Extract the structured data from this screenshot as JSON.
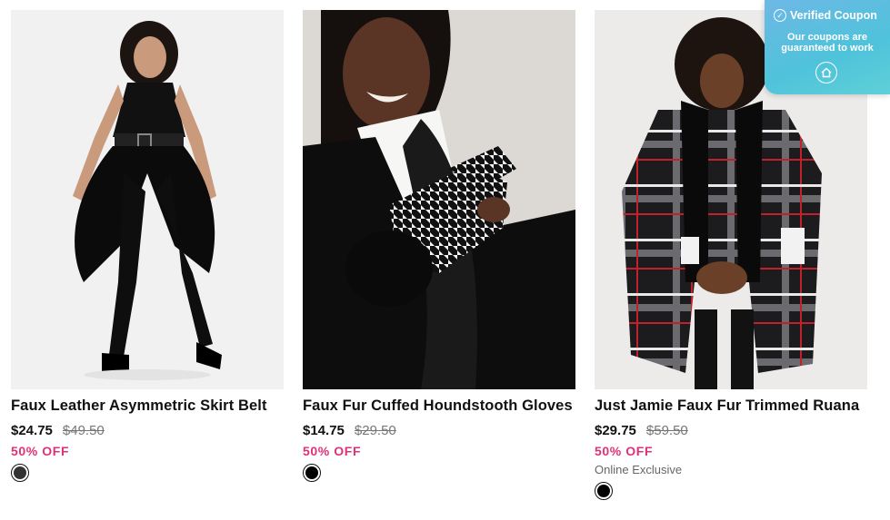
{
  "products": [
    {
      "name": "Faux Leather Asymmetric Skirt Belt",
      "price": "$24.75",
      "original_price": "$49.50",
      "discount": "50% OFF",
      "exclusive": "",
      "swatch_color": "#333333"
    },
    {
      "name": "Faux Fur Cuffed Houndstooth Gloves",
      "price": "$14.75",
      "original_price": "$29.50",
      "discount": "50% OFF",
      "exclusive": "",
      "swatch_color": "#000000"
    },
    {
      "name": "Just Jamie Faux Fur Trimmed Ruana",
      "price": "$29.75",
      "original_price": "$59.50",
      "discount": "50% OFF",
      "exclusive": "Online Exclusive",
      "swatch_color": "#000000"
    }
  ],
  "coupon_popup": {
    "title": "Verified Coupon",
    "text_line1": "Our coupons are",
    "text_line2": "guaranteed to work",
    "icons": [
      "check-circle-icon",
      "home-icon"
    ]
  },
  "colors": {
    "discount": "#e0307a",
    "popup_gradient_start": "#6db8e6",
    "popup_gradient_end": "#5fd0d8"
  }
}
